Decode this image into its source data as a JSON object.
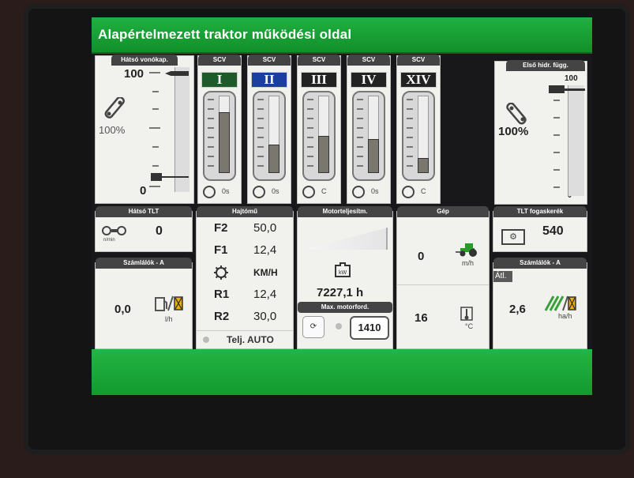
{
  "header": {
    "title": "Alapértelmezett traktor működési oldal"
  },
  "rear_hitch": {
    "title": "Hátsó vonókap.",
    "top": "100",
    "bottom": "0",
    "percent": "100%"
  },
  "front_hitch": {
    "title": "Első hidr. függ.",
    "top": "100",
    "bottom": "0",
    "percent": "100%"
  },
  "scv": [
    {
      "title": "SCV",
      "roman": "I",
      "level": 0.78,
      "mode": "0s",
      "color": "#1e5a2a"
    },
    {
      "title": "SCV",
      "roman": "II",
      "level": 0.35,
      "mode": "0s",
      "color": "#1a3fa0"
    },
    {
      "title": "SCV",
      "roman": "III",
      "level": 0.47,
      "mode": "C",
      "color": "#222222"
    },
    {
      "title": "SCV",
      "roman": "IV",
      "level": 0.43,
      "mode": "0s",
      "color": "#222222"
    },
    {
      "title": "SCV",
      "roman": "XIV",
      "level": 0.18,
      "mode": "C",
      "color": "#222222"
    }
  ],
  "rear_pto": {
    "title": "Hátsó TLT",
    "value": "0",
    "unit": "n/min"
  },
  "counters_left": {
    "title": "Számlálók - A",
    "value": "0,0",
    "unit": "l/h"
  },
  "drive": {
    "title": "Hajtómű",
    "rows": [
      {
        "label": "F2",
        "value": "50,0"
      },
      {
        "label": "F1",
        "value": "12,4"
      },
      {
        "label": "",
        "value": "KM/H"
      },
      {
        "label": "R1",
        "value": "12,4"
      },
      {
        "label": "R2",
        "value": "30,0"
      }
    ],
    "footer": "Telj. AUTO"
  },
  "engine": {
    "title": "Motorteljesítm.",
    "hours": "7227,1 h",
    "kw": "kW",
    "maxrpm_title": "Max. motorford.",
    "rpm": "1410"
  },
  "machine": {
    "title": "Gép",
    "speed": "0",
    "speed_unit": "m/h",
    "temp": "16",
    "temp_unit": "°C"
  },
  "front_pto": {
    "title": "TLT fogaskerék",
    "value": "540"
  },
  "counters_right": {
    "title": "Számlálók - A",
    "tag": "Átl.",
    "value": "2,6",
    "unit": "ha/h"
  },
  "colors": {
    "accent": "#11902a",
    "panel": "#f1f1ee",
    "header": "#444444"
  }
}
